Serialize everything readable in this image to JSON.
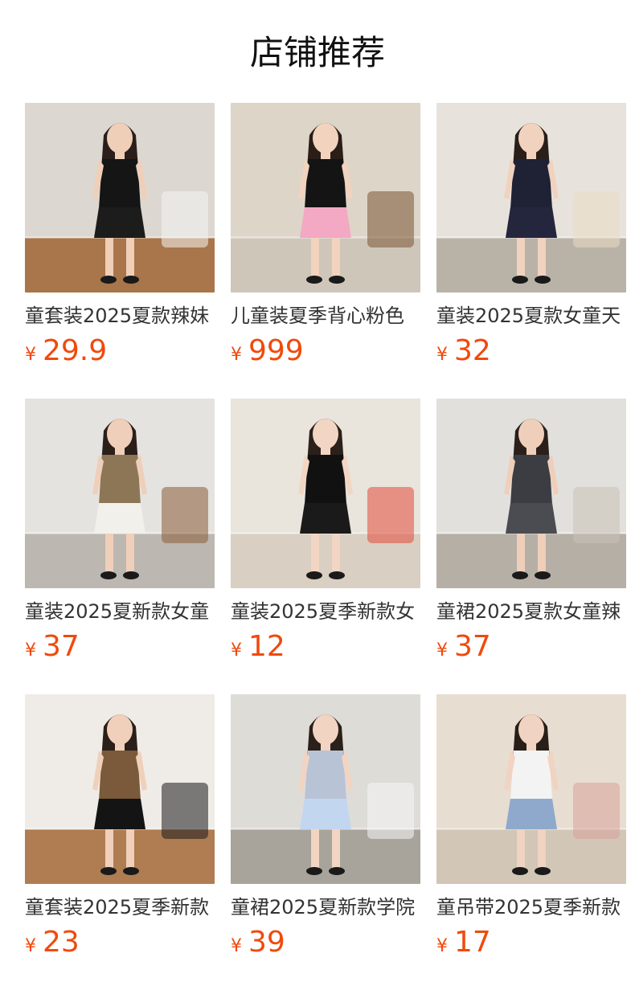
{
  "header": {
    "title": "店铺推荐"
  },
  "products": [
    {
      "name": "童套装2025夏款辣妹",
      "currency": "¥",
      "price": "29.9",
      "wall": "#dcd7d0",
      "floor": "#a9754a",
      "top": "#151515",
      "bottom": "#1c1c1c",
      "skin": "#f0cfb9",
      "hair": "#2a1f1a",
      "accent": "#f4f4f4"
    },
    {
      "name": "儿童装夏季背心粉色",
      "currency": "¥",
      "price": "999",
      "wall": "#ddd5c8",
      "floor": "#cfc6ba",
      "top": "#141414",
      "bottom": "#f3a8c3",
      "skin": "#f1d3be",
      "hair": "#2b1d17",
      "accent": "#7a5534"
    },
    {
      "name": "童装2025夏款女童天",
      "currency": "¥",
      "price": "32",
      "wall": "#e7e3dc",
      "floor": "#b9b2a7",
      "top": "#1f2235",
      "bottom": "#23263d",
      "skin": "#f0d2bf",
      "hair": "#2a1e19",
      "accent": "#e9dcc2"
    },
    {
      "name": "童装2025夏新款女童",
      "currency": "¥",
      "price": "37",
      "wall": "#e5e3df",
      "floor": "#bcb7b0",
      "top": "#8d7656",
      "bottom": "#f2f0ea",
      "skin": "#efcfb9",
      "hair": "#2b1f19",
      "accent": "#8a5d38"
    },
    {
      "name": "童装2025夏季新款女",
      "currency": "¥",
      "price": "12",
      "wall": "#e9e4dc",
      "floor": "#d9cfc2",
      "top": "#111111",
      "bottom": "#1a1a1a",
      "skin": "#f2d5c3",
      "hair": "#2c201a",
      "accent": "#e14a3a"
    },
    {
      "name": "童裙2025夏款女童辣",
      "currency": "¥",
      "price": "37",
      "wall": "#e2e0dc",
      "floor": "#b5afa6",
      "top": "#3b3d42",
      "bottom": "#4a4c52",
      "skin": "#efcfba",
      "hair": "#2a1f1a",
      "accent": "#c8c1b6"
    },
    {
      "name": "童套装2025夏季新款",
      "currency": "¥",
      "price": "23",
      "wall": "#efece7",
      "floor": "#b07c52",
      "top": "#7a5a3a",
      "bottom": "#141414",
      "skin": "#f0d0bb",
      "hair": "#2b1f19",
      "accent": "#1a1a1a"
    },
    {
      "name": "童裙2025夏新款学院",
      "currency": "¥",
      "price": "39",
      "wall": "#dedcd7",
      "floor": "#a8a39b",
      "top": "#b9c3d6",
      "bottom": "#c3d6ef",
      "skin": "#f1d4c2",
      "hair": "#2c201a",
      "accent": "#f5f5f5"
    },
    {
      "name": "童吊带2025夏季新款",
      "currency": "¥",
      "price": "17",
      "wall": "#e8ddd1",
      "floor": "#d2c6b6",
      "top": "#f3f3f3",
      "bottom": "#8fa9cc",
      "skin": "#f1d3c1",
      "hair": "#2a1e18",
      "accent": "#d7a39b"
    }
  ]
}
